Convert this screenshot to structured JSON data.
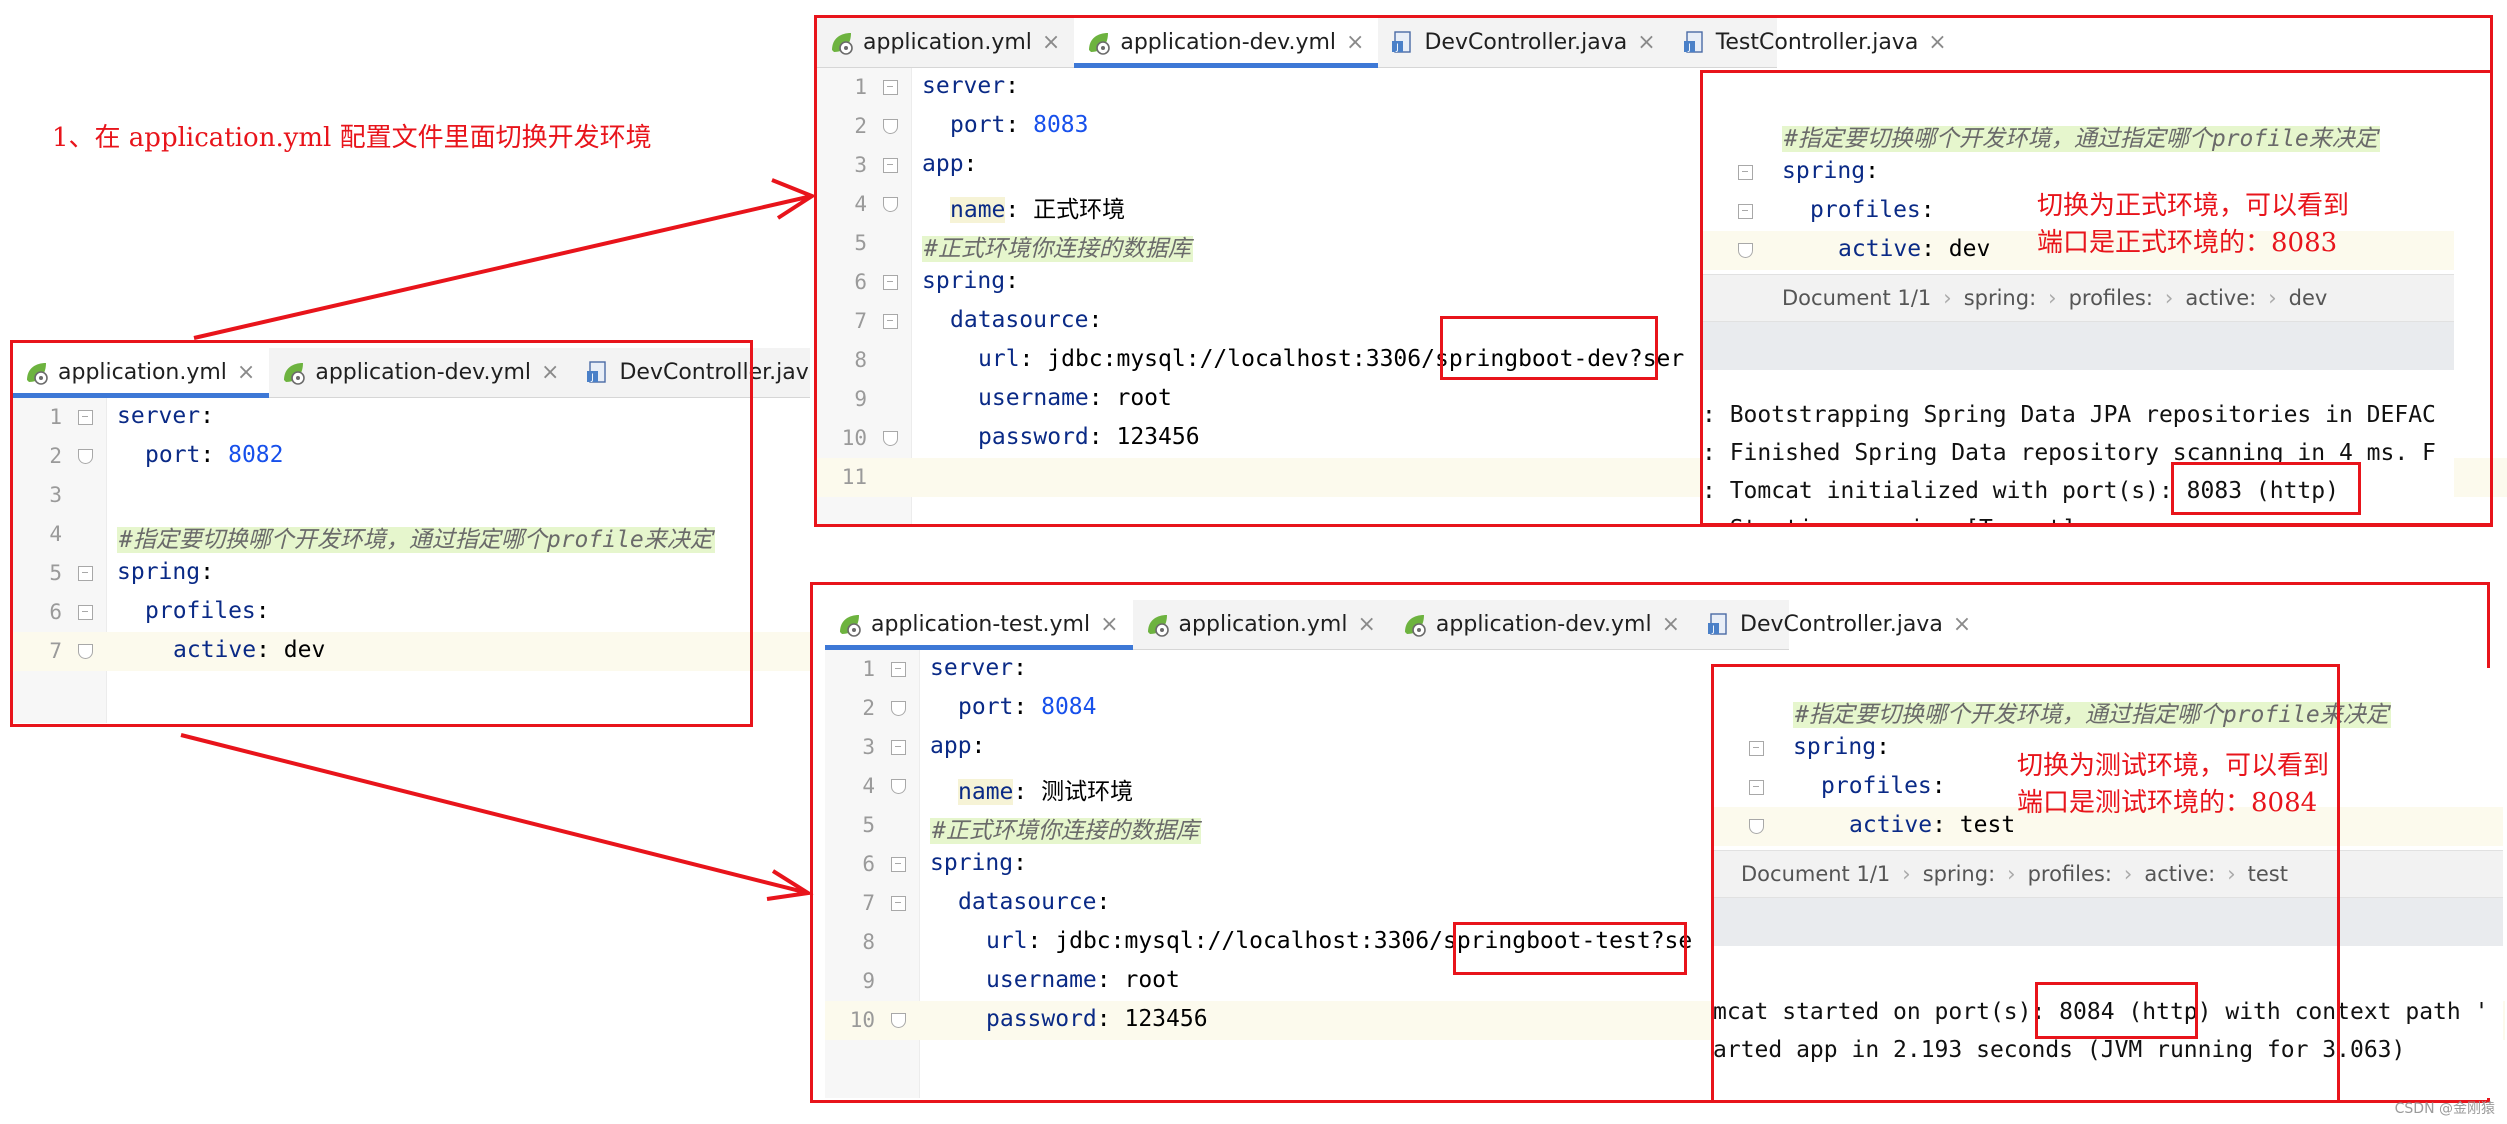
{
  "caption": "1、在 application.yml 配置文件里面切换开发环境",
  "watermark": "CSDN @金刚猿",
  "colors": {
    "annotation_red": "#e8141b",
    "tab_underline": "#3d78d6",
    "comment_bg": "#e6f6cd"
  },
  "panel_main": {
    "tabs": [
      {
        "label": "application.yml",
        "icon": "yaml-icon",
        "active": true
      },
      {
        "label": "application-dev.yml",
        "icon": "yaml-icon",
        "active": false
      },
      {
        "label": "DevController.java",
        "icon": "java-icon",
        "active": false
      }
    ],
    "lines": [
      {
        "num": "1",
        "key": "server",
        "val": ""
      },
      {
        "num": "2",
        "key": "port",
        "val": "8082"
      },
      {
        "num": "3",
        "key": "",
        "val": ""
      },
      {
        "num": "4",
        "comment": "#指定要切换哪个开发环境，通过指定哪个profile来决定"
      },
      {
        "num": "5",
        "key": "spring",
        "val": ""
      },
      {
        "num": "6",
        "key": "profiles",
        "val": ""
      },
      {
        "num": "7",
        "key": "active",
        "val": "dev"
      }
    ]
  },
  "panel_dev": {
    "tabs": [
      {
        "label": "application.yml",
        "icon": "yaml-icon",
        "active": false
      },
      {
        "label": "application-dev.yml",
        "icon": "yaml-icon",
        "active": true
      },
      {
        "label": "DevController.java",
        "icon": "java-icon",
        "active": false
      },
      {
        "label": "TestController.java",
        "icon": "java-icon",
        "active": false
      }
    ],
    "lines": [
      {
        "num": "1",
        "key": "server"
      },
      {
        "num": "2",
        "key": "port",
        "val": "8083"
      },
      {
        "num": "3",
        "key": "app"
      },
      {
        "num": "4",
        "key": "name",
        "val": "正式环境"
      },
      {
        "num": "5",
        "comment": "#正式环境你连接的数据库"
      },
      {
        "num": "6",
        "key": "spring"
      },
      {
        "num": "7",
        "key": "datasource"
      },
      {
        "num": "8",
        "key": "url",
        "val_pre": "jdbc:mysql://localhost:3306/",
        "val_hl": "springboot-dev?",
        "val_post": "ser"
      },
      {
        "num": "9",
        "key": "username",
        "val": "root"
      },
      {
        "num": "10",
        "key": "password",
        "val": "123456"
      },
      {
        "num": "11"
      }
    ],
    "overlay": {
      "comment": "#指定要切换哪个开发环境，通过指定哪个profile来决定",
      "spring": "spring",
      "profiles": "profiles",
      "active_key": "active",
      "active_val": "dev",
      "crumb": [
        "Document 1/1",
        "spring:",
        "profiles:",
        "active:",
        "dev"
      ],
      "console": [
        ": Bootstrapping Spring Data JPA repositories in DEFAC",
        ": Finished Spring Data repository scanning in 4 ms. F",
        ": Tomcat initialized with port(s): 8083 (http)",
        ": Starting service [Tomcat]"
      ],
      "note": [
        "切换为正式环境，可以看到",
        "端口是正式环境的：8083"
      ]
    }
  },
  "panel_test": {
    "tabs": [
      {
        "label": "application-test.yml",
        "icon": "yaml-icon",
        "active": true
      },
      {
        "label": "application.yml",
        "icon": "yaml-icon",
        "active": false
      },
      {
        "label": "application-dev.yml",
        "icon": "yaml-icon",
        "active": false
      },
      {
        "label": "DevController.java",
        "icon": "java-icon",
        "active": false
      }
    ],
    "lines": [
      {
        "num": "1",
        "key": "server"
      },
      {
        "num": "2",
        "key": "port",
        "val": "8084"
      },
      {
        "num": "3",
        "key": "app"
      },
      {
        "num": "4",
        "key": "name",
        "val": "测试环境"
      },
      {
        "num": "5",
        "comment": "#正式环境你连接的数据库"
      },
      {
        "num": "6",
        "key": "spring"
      },
      {
        "num": "7",
        "key": "datasource"
      },
      {
        "num": "8",
        "key": "url",
        "val_pre": "jdbc:mysql://localhost:3306/",
        "val_hl": "springboot-test?",
        "val_post": "se"
      },
      {
        "num": "9",
        "key": "username",
        "val": "root"
      },
      {
        "num": "10",
        "key": "password",
        "val": "123456"
      }
    ],
    "overlay": {
      "comment": "#指定要切换哪个开发环境，通过指定哪个profile来决定",
      "spring": "spring",
      "profiles": "profiles",
      "active_key": "active",
      "active_val": "test",
      "crumb": [
        "Document 1/1",
        "spring:",
        "profiles:",
        "active:",
        "test"
      ],
      "console": [
        "mcat started on port(s): 8084 (http) with context path '",
        "arted app in 2.193 seconds (JVM running for 3.063)"
      ],
      "note": [
        "切换为测试环境，可以看到",
        "端口是测试环境的：8084"
      ]
    }
  }
}
